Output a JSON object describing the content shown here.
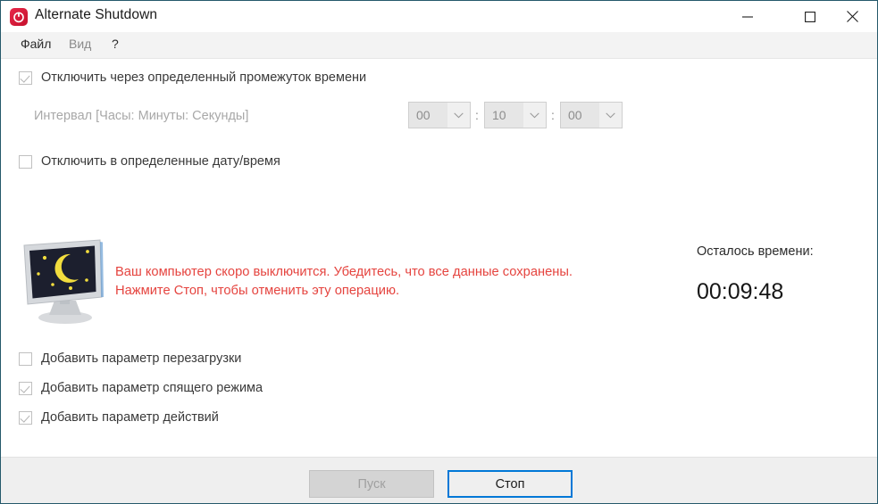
{
  "window": {
    "title": "Alternate Shutdown",
    "icon": "power-icon",
    "border_color": "#25596b",
    "controls": {
      "minimize": "minimize-icon",
      "maximize": "maximize-icon",
      "close": "close-icon"
    }
  },
  "menu": {
    "items": [
      {
        "label": "Файл",
        "enabled": true
      },
      {
        "label": "Вид",
        "enabled": false
      },
      {
        "label": "?",
        "enabled": true
      }
    ]
  },
  "main": {
    "shutdown_after_interval": {
      "label": "Отключить через определенный промежуток времени",
      "checked": true,
      "enabled": false
    },
    "interval": {
      "label": "Интервал [Часы: Минуты: Секунды]",
      "separator": ":",
      "hours": "00",
      "minutes": "10",
      "seconds": "00",
      "enabled": false
    },
    "shutdown_at_datetime": {
      "label": "Отключить в определенные дату/время",
      "checked": false,
      "enabled": true
    },
    "illustration": "sleeping-monitor-icon",
    "warning": {
      "line1": "Ваш компьютер скоро выключится. Убедитесь, что все данные сохранены.",
      "line2": "Нажмите Стоп, чтобы отменить эту операцию.",
      "color": "#e5443f"
    },
    "remaining": {
      "label": "Осталось времени:",
      "value": "00:09:48"
    },
    "options": [
      {
        "label": "Добавить параметр перезагрузки",
        "checked": false
      },
      {
        "label": "Добавить параметр спящего режима",
        "checked": true
      },
      {
        "label": "Добавить параметр действий",
        "checked": true
      }
    ]
  },
  "footer": {
    "start_label": "Пуск",
    "start_enabled": false,
    "stop_label": "Стоп",
    "stop_enabled": true,
    "focus_color": "#0078d7"
  }
}
